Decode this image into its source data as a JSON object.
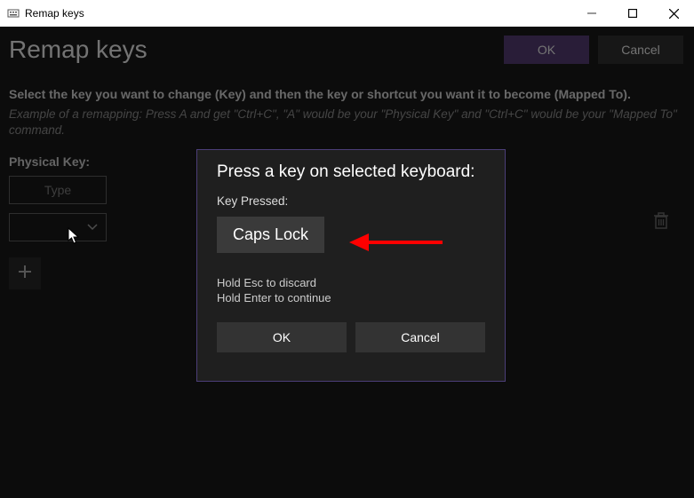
{
  "titlebar": {
    "text": "Remap keys"
  },
  "header": {
    "title": "Remap keys",
    "ok": "OK",
    "cancel": "Cancel"
  },
  "instructions": "Select the key you want to change (Key) and then the key or shortcut you want it to become (Mapped To).",
  "example": "Example of a remapping: Press A and get \"Ctrl+C\", \"A\" would be your \"Physical Key\" and \"Ctrl+C\" would be your \"Mapped To\" command.",
  "section": {
    "physical_key": "Physical Key:"
  },
  "type_button": "Type",
  "modal": {
    "title": "Press a key on selected keyboard:",
    "subtitle": "Key Pressed:",
    "key": "Caps Lock",
    "hint1": "Hold Esc to discard",
    "hint2": "Hold Enter to continue",
    "ok": "OK",
    "cancel": "Cancel"
  }
}
